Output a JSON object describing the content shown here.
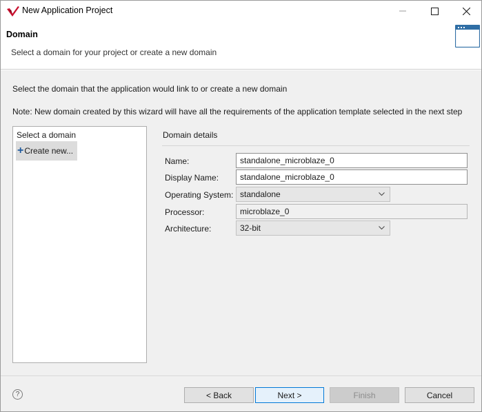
{
  "window": {
    "title": "New Application Project",
    "minimize_icon": "minimize-icon",
    "maximize_icon": "maximize-icon",
    "close_icon": "close-icon"
  },
  "header": {
    "title": "Domain",
    "subtitle": "Select a domain for your project or create a new domain",
    "icon": "wizard-window-icon"
  },
  "instructions": {
    "line1": "Select the domain that the application would link to or create a new domain",
    "line2": "Note: New domain created by this wizard will have all the requirements of the application template selected in the next step"
  },
  "domain_list": {
    "header": "Select a domain",
    "items": [
      {
        "label": "Create new...",
        "icon": "plus-icon",
        "selected": true
      }
    ]
  },
  "details": {
    "title": "Domain details",
    "fields": {
      "name": {
        "label": "Name:",
        "value": "standalone_microblaze_0"
      },
      "display_name": {
        "label": "Display Name:",
        "value": "standalone_microblaze_0"
      },
      "os": {
        "label": "Operating System:",
        "value": "standalone"
      },
      "processor": {
        "label": "Processor:",
        "value": "microblaze_0"
      },
      "architecture": {
        "label": "Architecture:",
        "value": "32-bit"
      }
    }
  },
  "footer": {
    "help": "?",
    "back": "< Back",
    "next": "Next >",
    "finish": "Finish",
    "cancel": "Cancel"
  },
  "colors": {
    "accent_border": "#0078d7",
    "logo_red": "#c8102e",
    "plus_blue": "#1f5a9e"
  }
}
